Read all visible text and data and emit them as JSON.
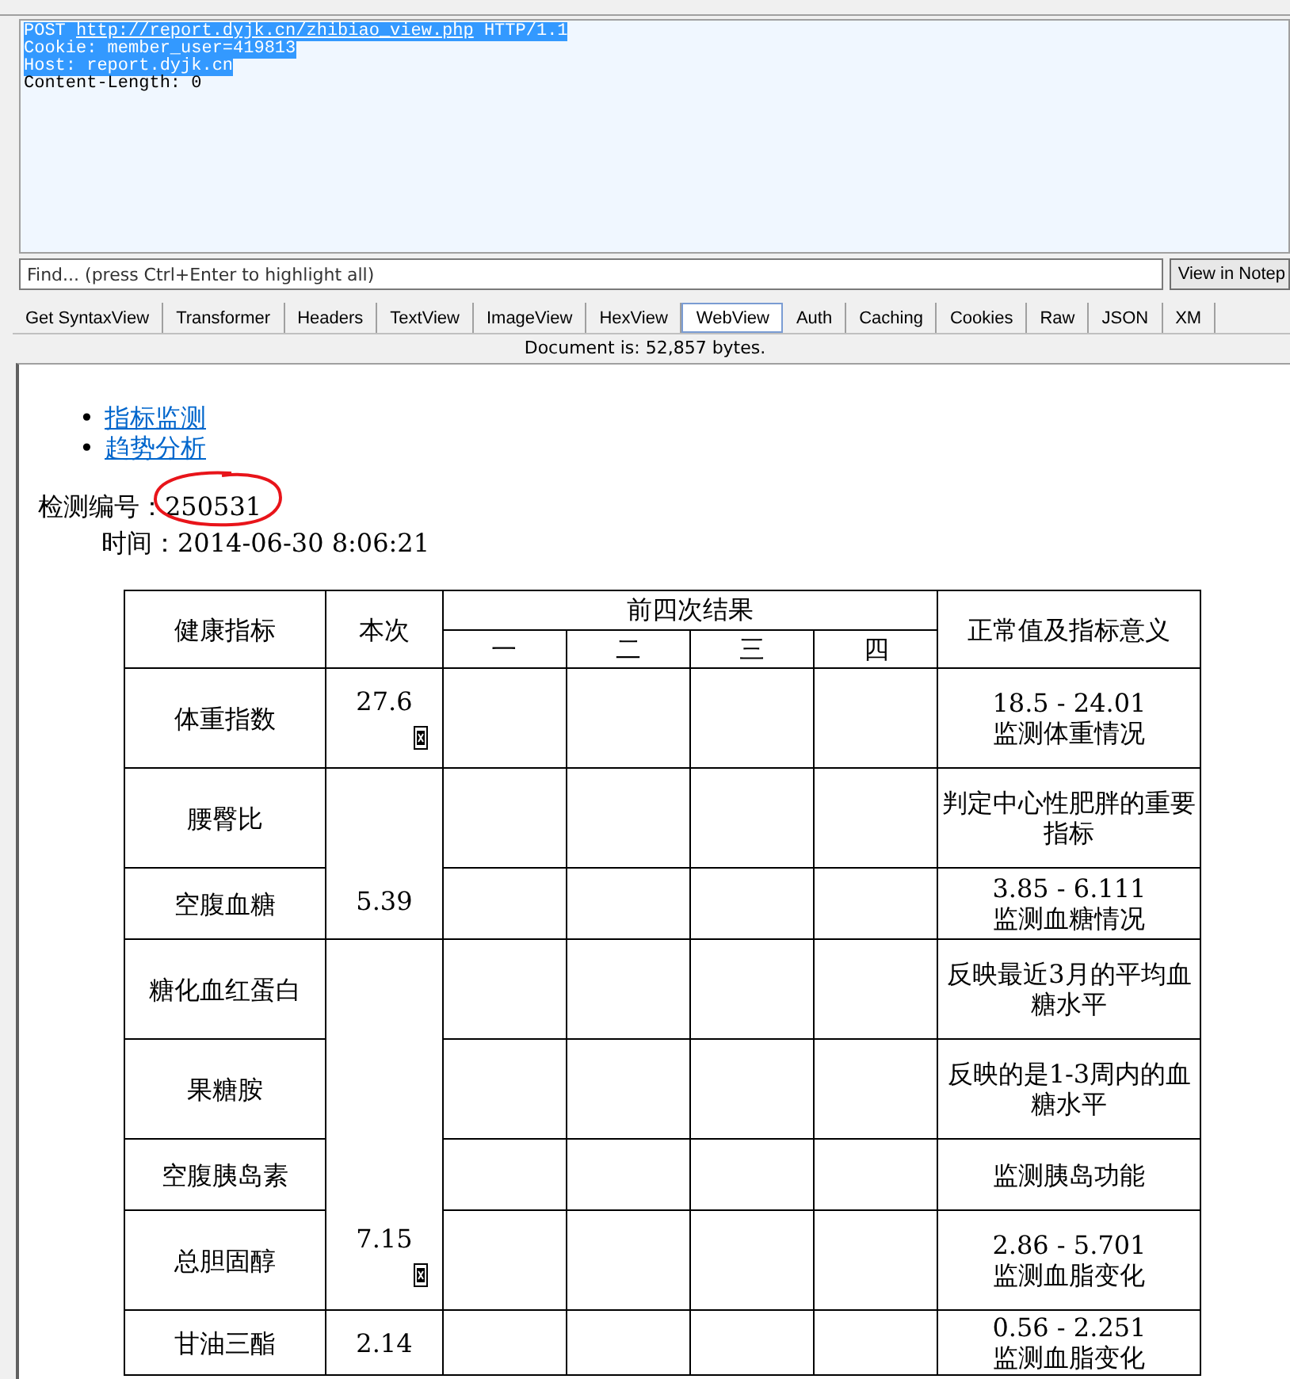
{
  "request": {
    "lines": [
      {
        "prefix": "POST ",
        "link": "http://report.dyjk.cn/zhibiao_view.php",
        "suffix": " HTTP/1.1",
        "selected": true
      },
      {
        "text": "Cookie: member_user=419813",
        "selected": true
      },
      {
        "text": "Host: report.dyjk.cn",
        "selected": true
      },
      {
        "text": "Content-Length: 0",
        "selected": false
      }
    ]
  },
  "find": {
    "placeholder": "Find... (press Ctrl+Enter to highlight all)",
    "button": "View in Notep"
  },
  "tabs": [
    {
      "label": "Get SyntaxView",
      "selected": false
    },
    {
      "label": "Transformer",
      "selected": false
    },
    {
      "label": "Headers",
      "selected": false
    },
    {
      "label": "TextView",
      "selected": false
    },
    {
      "label": "ImageView",
      "selected": false
    },
    {
      "label": "HexView",
      "selected": false
    },
    {
      "label": "WebView",
      "selected": true
    },
    {
      "label": "Auth",
      "selected": false
    },
    {
      "label": "Caching",
      "selected": false
    },
    {
      "label": "Cookies",
      "selected": false
    },
    {
      "label": "Raw",
      "selected": false
    },
    {
      "label": "JSON",
      "selected": false
    },
    {
      "label": "XM",
      "selected": false
    }
  ],
  "status": "Document is: 52,857 bytes.",
  "page": {
    "links": [
      {
        "bullet": "•",
        "label": "指标监测"
      },
      {
        "bullet": "•",
        "label": "趋势分析"
      }
    ],
    "id_label": "检测编号：",
    "id_value": "250531",
    "time_label": "时间：",
    "time_value": "2014-06-30 8:06:21",
    "table": {
      "headers": {
        "indicator": "健康指标",
        "current": "本次",
        "previous": "前四次结果",
        "previous_columns": [
          "一",
          "二",
          "三",
          "四"
        ],
        "normal": "正常值及指标意义"
      },
      "groups": [
        {
          "current": "27.6",
          "broken_image": true,
          "rows": [
            {
              "name": "体重指数",
              "range": "18.5 - 24.01",
              "meaning": "监测体重情况"
            }
          ]
        },
        {
          "current": "5.39",
          "broken_image": false,
          "rows": [
            {
              "name": "腰臀比",
              "meaning": "判定中心性肥胖的重要指标"
            },
            {
              "name": "空腹血糖",
              "range": "3.85 - 6.111",
              "meaning": "监测血糖情况"
            }
          ]
        },
        {
          "current": "7.15",
          "broken_image": true,
          "rows": [
            {
              "name": "糖化血红蛋白",
              "meaning": "反映最近3月的平均血糖水平"
            },
            {
              "name": "果糖胺",
              "meaning": "反映的是1-3周内的血糖水平"
            },
            {
              "name": "空腹胰岛素",
              "meaning": "监测胰岛功能"
            },
            {
              "name": "总胆固醇",
              "range": "2.86 - 5.701",
              "meaning": "监测血脂变化"
            }
          ]
        },
        {
          "current": "2.14",
          "broken_image": false,
          "rows": [
            {
              "name": "甘油三酯",
              "range": "0.56 - 2.251",
              "meaning": "监测血脂变化"
            }
          ]
        }
      ]
    }
  }
}
